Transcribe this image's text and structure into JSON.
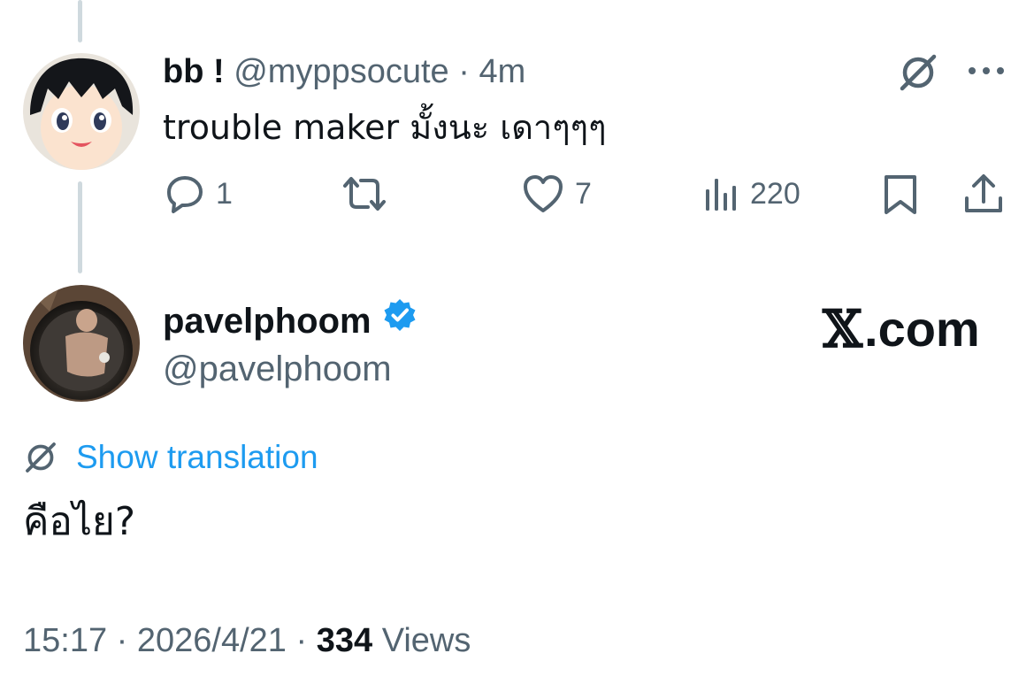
{
  "reply": {
    "display_name": "bb !",
    "handle": "@myppsocute",
    "separator": "·",
    "time": "4m",
    "text": "trouble maker มั้งนะ เดาๆๆๆ",
    "actions": {
      "reply_count": "1",
      "repost_count": "",
      "like_count": "7",
      "views_count": "220"
    },
    "icons": [
      "translate-icon",
      "more-icon",
      "reply-icon",
      "repost-icon",
      "like-icon",
      "views-icon",
      "bookmark-icon",
      "share-icon"
    ]
  },
  "main": {
    "display_name": "pavelphoom",
    "handle": "@pavelphoom",
    "verified": true,
    "show_translation_label": "Show translation",
    "text": "คือไย?",
    "time": "15:17",
    "separator": "·",
    "date": "2026/4/21",
    "views_count": "334",
    "views_label": "Views"
  },
  "brand": {
    "mark": "𝕏",
    "suffix": ".com"
  },
  "colors": {
    "accent": "#1d9bf0",
    "muted": "#536471",
    "text": "#0f1419",
    "thread_line": "#cfd9de"
  }
}
